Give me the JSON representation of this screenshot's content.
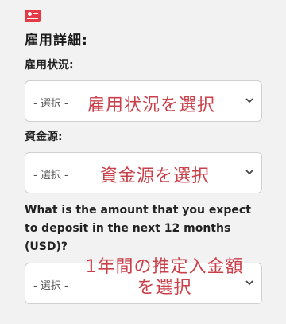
{
  "section": {
    "icon": "id-card-icon",
    "title": "雇用詳細:"
  },
  "fields": [
    {
      "label": "雇用状況:",
      "placeholder": "- 選択 -",
      "overlay": "雇用状況を選択"
    },
    {
      "label": "資金源:",
      "placeholder": "- 選択 -",
      "overlay": "資金源を選択"
    },
    {
      "label": "What is the amount that you expect to deposit in the next 12 months (USD)?",
      "placeholder": "- 選択 -",
      "overlay_line1": "1年間の推定入金額",
      "overlay_line2": "を選択"
    }
  ],
  "colors": {
    "accent": "#e53945",
    "overlay_text": "#c9404a",
    "background": "#f2f2f2"
  }
}
